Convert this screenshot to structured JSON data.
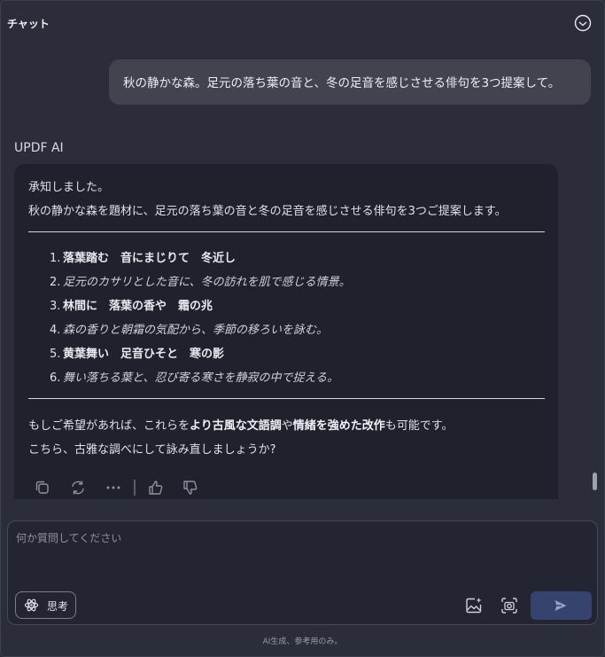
{
  "header": {
    "title": "チャット",
    "history_icon": "clock-icon"
  },
  "user_message": "秋の静かな森。足元の落ち葉の音と、冬の足音を感じさせる俳句を3つ提案して。",
  "ai": {
    "label": "UPDF AI",
    "intro1": "承知しました。",
    "intro2": "秋の静かな森を題材に、足元の落ち葉の音と冬の足音を感じさせる俳句を3つご提案します。",
    "items": [
      {
        "num": "1.",
        "text": "落葉踏む　音にまじりて　冬近し",
        "style": "bold"
      },
      {
        "num": "2.",
        "text": "足元のカサリとした音に、冬の訪れを肌で感じる情景。",
        "style": "italic"
      },
      {
        "num": "3.",
        "text": "林間に　落葉の香や　霜の兆",
        "style": "bold"
      },
      {
        "num": "4.",
        "text": "森の香りと朝霜の気配から、季節の移ろいを詠む。",
        "style": "italic"
      },
      {
        "num": "5.",
        "text": "黄葉舞い　足音ひそと　寒の影",
        "style": "bold"
      },
      {
        "num": "6.",
        "text": "舞い落ちる葉と、忍び寄る寒さを静寂の中で捉える。",
        "style": "italic"
      }
    ],
    "outro1_a": "もしご希望があれば、これらを",
    "outro1_b": "より古風な文語調",
    "outro1_c": "や",
    "outro1_d": "情緒を強めた改作",
    "outro1_e": "も可能です。",
    "outro2": "こちら、古雅な調べにして詠み直しましょうか?",
    "actions": [
      "copy-icon",
      "regenerate-icon",
      "more-icon",
      "thumbs-up-icon",
      "thumbs-down-icon"
    ]
  },
  "input": {
    "placeholder": "何か質問してください",
    "think_label": "思考",
    "buttons": [
      "image-ai-icon",
      "screenshot-icon",
      "send-icon"
    ]
  },
  "footer": "AI生成、参考用のみ。",
  "colors": {
    "background": "#2b2d3a",
    "card": "#20212c",
    "user_bubble": "#41444f",
    "send": "#36436e"
  }
}
